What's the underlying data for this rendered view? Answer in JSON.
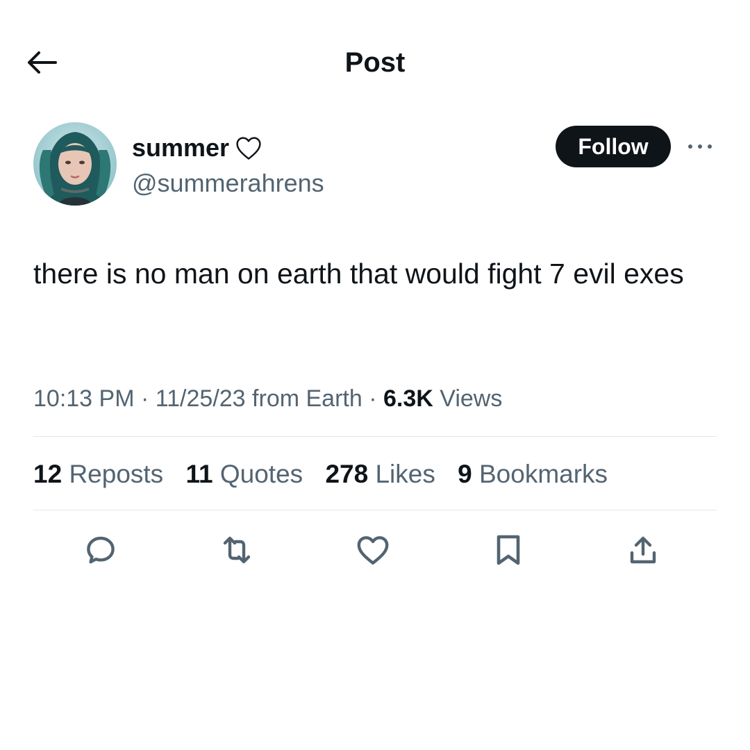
{
  "header": {
    "title": "Post",
    "back_icon": "arrow-left-icon"
  },
  "author": {
    "display_name": "summer",
    "name_icon": "heart-outline-icon",
    "handle": "@summerahrens",
    "avatar_icon": "avatar-photo",
    "follow_label": "Follow",
    "more_icon": "more-horizontal-icon"
  },
  "post": {
    "text": "there is no man on earth that would fight 7 evil exes"
  },
  "meta": {
    "time": "10:13 PM",
    "date": "11/25/23",
    "location": "from Earth",
    "views_count": "6.3K",
    "views_label": "Views",
    "separator": "·"
  },
  "stats": [
    {
      "count": "12",
      "label": "Reposts"
    },
    {
      "count": "11",
      "label": "Quotes"
    },
    {
      "count": "278",
      "label": "Likes"
    },
    {
      "count": "9",
      "label": "Bookmarks"
    }
  ],
  "actions": [
    {
      "name": "reply",
      "icon": "reply-icon"
    },
    {
      "name": "repost",
      "icon": "repost-icon"
    },
    {
      "name": "like",
      "icon": "heart-outline-icon"
    },
    {
      "name": "bookmark",
      "icon": "bookmark-icon"
    },
    {
      "name": "share",
      "icon": "share-icon"
    }
  ],
  "colors": {
    "text_primary": "#0f1419",
    "text_secondary": "#536471",
    "divider": "#e1e5e8",
    "follow_bg": "#0f1419",
    "follow_text": "#ffffff"
  }
}
